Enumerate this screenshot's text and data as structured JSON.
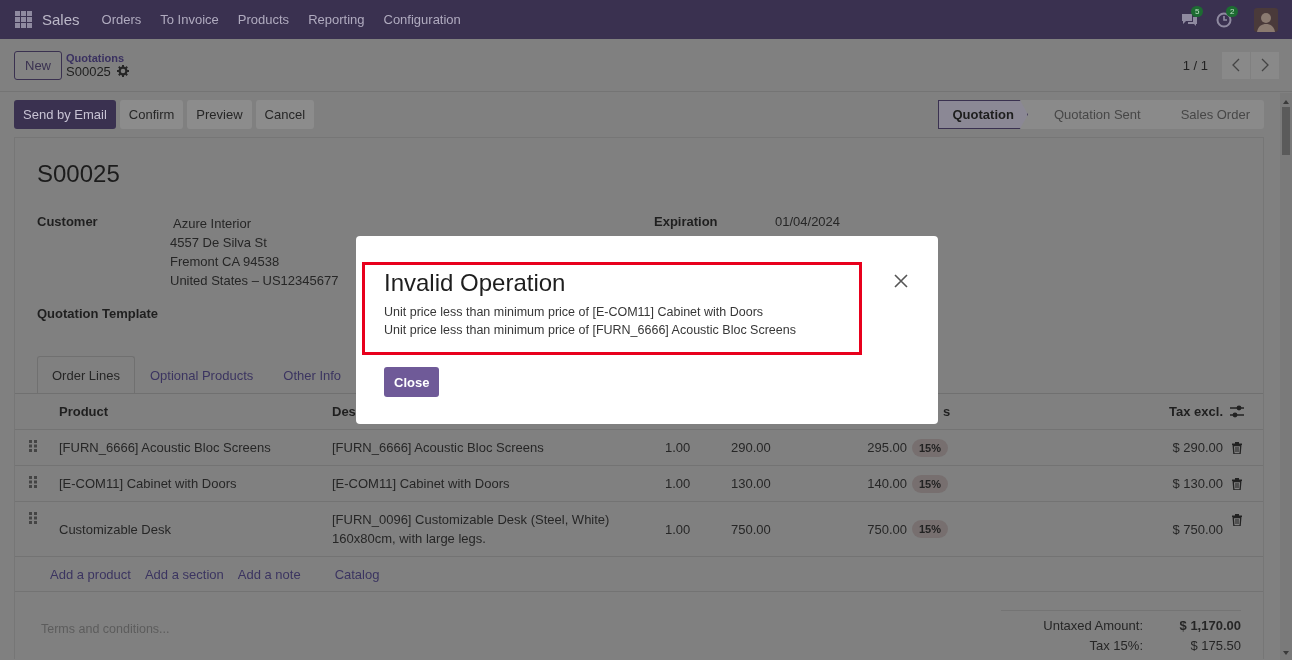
{
  "navbar": {
    "app": "Sales",
    "menu": [
      "Orders",
      "To Invoice",
      "Products",
      "Reporting",
      "Configuration"
    ],
    "messages_badge": "5",
    "activities_badge": "2"
  },
  "control_panel": {
    "new_button": "New",
    "breadcrumb": "Quotations",
    "record": "S00025",
    "pager": "1 / 1"
  },
  "actions": [
    {
      "label": "Send by Email",
      "primary": true
    },
    {
      "label": "Confirm",
      "primary": false
    },
    {
      "label": "Preview",
      "primary": false
    },
    {
      "label": "Cancel",
      "primary": false
    }
  ],
  "statusbar": [
    {
      "label": "Quotation",
      "selected": true
    },
    {
      "label": "Quotation Sent",
      "selected": false
    },
    {
      "label": "Sales Order",
      "selected": false
    }
  ],
  "form": {
    "title": "S00025",
    "customer_label": "Customer",
    "customer": "Azure Interior",
    "address": [
      "4557 De Silva St",
      "Fremont CA 94538",
      "United States – US12345677"
    ],
    "expiration_label": "Expiration",
    "expiration": "01/04/2024",
    "template_label": "Quotation Template"
  },
  "tabs": [
    {
      "label": "Order Lines",
      "selected": true
    },
    {
      "label": "Optional Products",
      "selected": false
    },
    {
      "label": "Other Info",
      "selected": false
    }
  ],
  "table": {
    "columns": [
      {
        "label": "Product"
      },
      {
        "label": "Des"
      },
      {
        "label": "s"
      },
      {
        "label": "Tax excl."
      }
    ],
    "rows": [
      {
        "product": "[FURN_6666] Acoustic Bloc Screens",
        "description": [
          "[FURN_6666] Acoustic Bloc Screens"
        ],
        "quantity": "1.00",
        "unit_price": "290.00",
        "column_6": "295.00",
        "tax": "15%",
        "subtotal": "$ 290.00"
      },
      {
        "product": "[E-COM11] Cabinet with Doors",
        "description": [
          "[E-COM11] Cabinet with Doors"
        ],
        "quantity": "1.00",
        "unit_price": "130.00",
        "column_6": "140.00",
        "tax": "15%",
        "subtotal": "$ 130.00"
      },
      {
        "product": "Customizable Desk",
        "description": [
          "[FURN_0096] Customizable Desk (Steel, White)",
          "160x80cm, with large legs."
        ],
        "quantity": "1.00",
        "unit_price": "750.00",
        "column_6": "750.00",
        "tax": "15%",
        "subtotal": "$ 750.00"
      }
    ],
    "add_links": [
      "Add a product",
      "Add a section",
      "Add a note",
      "Catalog"
    ]
  },
  "terms_placeholder": "Terms and conditions...",
  "totals": [
    {
      "label": "Untaxed Amount:",
      "value": "$ 1,170.00",
      "bold": true
    },
    {
      "label": "Tax 15%:",
      "value": "$ 175.50",
      "bold": false
    }
  ],
  "dialog": {
    "title": "Invalid Operation",
    "messages": [
      "Unit price less than minimum price of [E-COM11] Cabinet with Doors",
      "Unit price less than minimum price of [FURN_6666] Acoustic Bloc Screens"
    ],
    "close_button": "Close"
  }
}
